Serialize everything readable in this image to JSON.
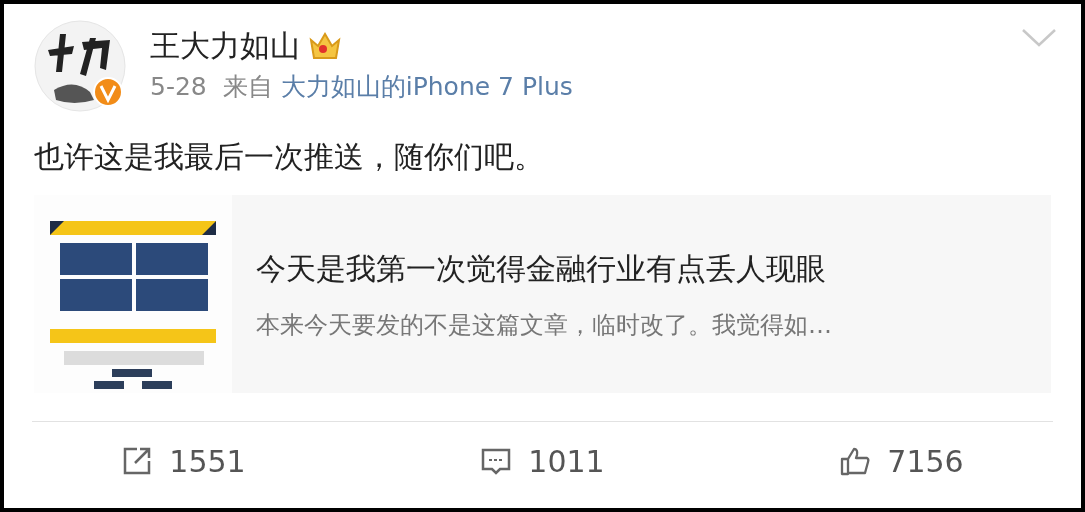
{
  "post": {
    "author": "王大力如山",
    "date": "5-28",
    "source_prefix": "来自",
    "source": "大力如山的iPhone 7 Plus",
    "text": "也许这是我最后一次推送，随你们吧。"
  },
  "article": {
    "title": "今天是我第一次觉得金融行业有点丢人现眼",
    "summary": "本来今天要发的不是这篇文章，临时改了。我觉得如…"
  },
  "actions": [
    {
      "kind": "repost",
      "count": "1551"
    },
    {
      "kind": "comment",
      "count": "1011"
    },
    {
      "kind": "like",
      "count": "7156"
    }
  ]
}
